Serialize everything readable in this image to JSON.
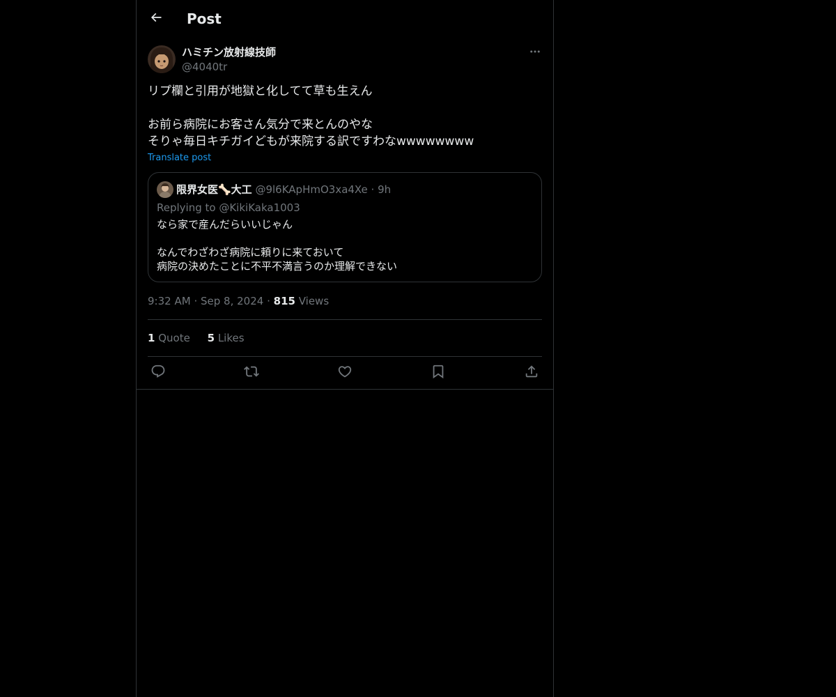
{
  "header": {
    "title": "Post",
    "back_icon": "arrow-left-icon"
  },
  "colors": {
    "background": "#000000",
    "text_primary": "#e7e9ea",
    "text_secondary": "#71767b",
    "link": "#1d9bf0",
    "border": "#2f3336"
  },
  "post": {
    "author": {
      "name": "ハミチン放射線技師",
      "handle": "@4040tr"
    },
    "more_icon": "more-horizontal-icon",
    "text_lines": [
      "リプ欄と引用が地獄と化してて草も生えん",
      "",
      "お前ら病院にお客さん気分で来とんのやな",
      "そりゃ毎日キチガイどもが来院する訳ですわなwwwwwwww"
    ],
    "translate_label": "Translate post",
    "time": "9:32 AM",
    "date": "Sep 8, 2024",
    "views_count": "815",
    "views_label": "Views",
    "separator": "·",
    "quote_count": "1",
    "quote_label": "Quote",
    "likes_count": "5",
    "likes_label": "Likes"
  },
  "quoted_post": {
    "name": "限界女医🦴大工",
    "handle": "@9l6KApHmO3xa4Xe",
    "separator": "·",
    "time": "9h",
    "replying_to": "Replying to @KikiKaka1003",
    "text_lines": [
      "なら家で産んだらいいじゃん",
      "",
      "なんでわざわざ病院に頼りに来ておいて",
      "病院の決めたことに不平不満言うのか理解できない"
    ]
  },
  "actions": [
    {
      "name": "reply-icon"
    },
    {
      "name": "repost-icon"
    },
    {
      "name": "like-icon"
    },
    {
      "name": "bookmark-icon"
    },
    {
      "name": "share-icon"
    }
  ]
}
